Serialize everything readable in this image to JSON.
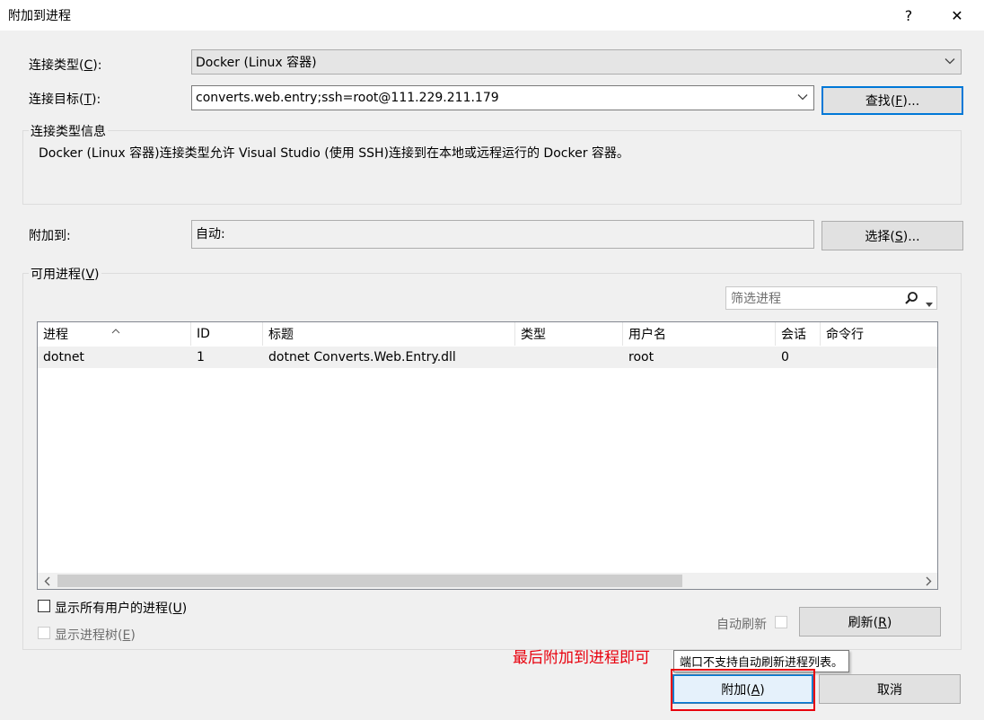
{
  "window": {
    "title": "附加到进程",
    "help_glyph": "?",
    "close_glyph": "✕"
  },
  "connection": {
    "type_label": "连接类型",
    "type_accel": "C",
    "type_value": "Docker (Linux 容器)",
    "target_label": "连接目标",
    "target_accel": "T",
    "target_value": "converts.web.entry;ssh=root@111.229.211.179",
    "find_button_label": "查找",
    "find_button_accel": "F",
    "find_button_suffix": "..."
  },
  "info": {
    "legend": "连接类型信息",
    "text": "Docker (Linux 容器)连接类型允许 Visual Studio (使用 SSH)连接到在本地或远程运行的 Docker 容器。"
  },
  "attach_to": {
    "label": "附加到:",
    "value": "自动:",
    "select_button_label": "选择",
    "select_button_accel": "S",
    "select_button_suffix": "..."
  },
  "processes": {
    "legend": "可用进程",
    "legend_accel": "V",
    "filter_placeholder": "筛选进程",
    "columns": [
      "进程",
      "ID",
      "标题",
      "类型",
      "用户名",
      "会话",
      "命令行"
    ],
    "rows": [
      {
        "process": "dotnet",
        "id": "1",
        "title": "dotnet Converts.Web.Entry.dll",
        "type": "",
        "user": "root",
        "session": "0",
        "cmdline": ""
      }
    ],
    "show_all_users_label": "显示所有用户的进程",
    "show_all_users_accel": "U",
    "show_all_users_checked": false,
    "show_tree_label": "显示进程树",
    "show_tree_accel": "E",
    "show_tree_enabled": false,
    "auto_refresh_label": "自动刷新",
    "auto_refresh_checked": false,
    "refresh_button_label": "刷新",
    "refresh_button_accel": "R"
  },
  "tooltip": {
    "text": "端口不支持自动刷新进程列表。"
  },
  "annotation": {
    "text": "最后附加到进程即可",
    "color": "#e8000d"
  },
  "footer": {
    "attach_button_label": "附加",
    "attach_button_accel": "A",
    "cancel_button_label": "取消"
  },
  "icons": {
    "search": "search-icon",
    "dropdown": "chevron-down-icon",
    "sort": "sort-ascending-icon",
    "scroll_left": "chevron-left-icon",
    "scroll_right": "chevron-right-icon"
  },
  "colors": {
    "focus_blue": "#0078d7",
    "annotation_red": "#e8000d"
  }
}
